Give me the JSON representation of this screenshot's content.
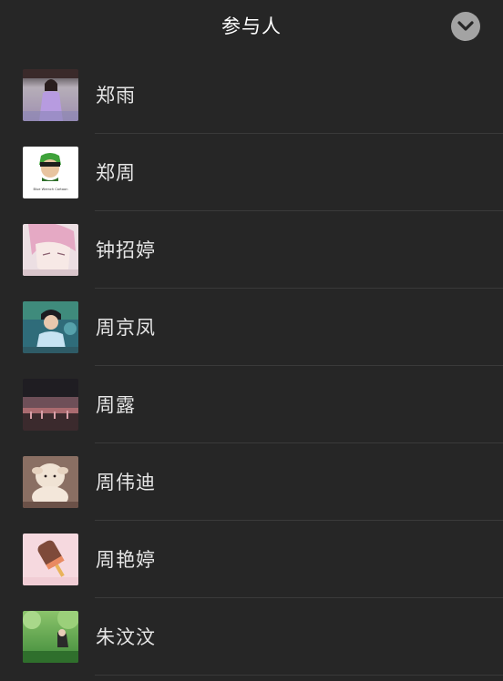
{
  "header": {
    "title": "参与人",
    "collapse_icon": "chevron-down-icon"
  },
  "participants": [
    {
      "name": "郑雨",
      "avatar": "girl-lavender-dress-photo"
    },
    {
      "name": "郑周",
      "avatar": "cartoon-green-hair-logo",
      "avatar_caption": "Blue Wrench Cartoon"
    },
    {
      "name": "钟招婷",
      "avatar": "anime-boy-pink-hair"
    },
    {
      "name": "周京凤",
      "avatar": "boy-school-uniform-photo"
    },
    {
      "name": "周露",
      "avatar": "stadium-dusk-photo"
    },
    {
      "name": "周伟迪",
      "avatar": "plush-lamb-toy-photo"
    },
    {
      "name": "周艳婷",
      "avatar": "popsicle-pink-photo"
    },
    {
      "name": "朱汶汶",
      "avatar": "green-forest-photo"
    }
  ]
}
